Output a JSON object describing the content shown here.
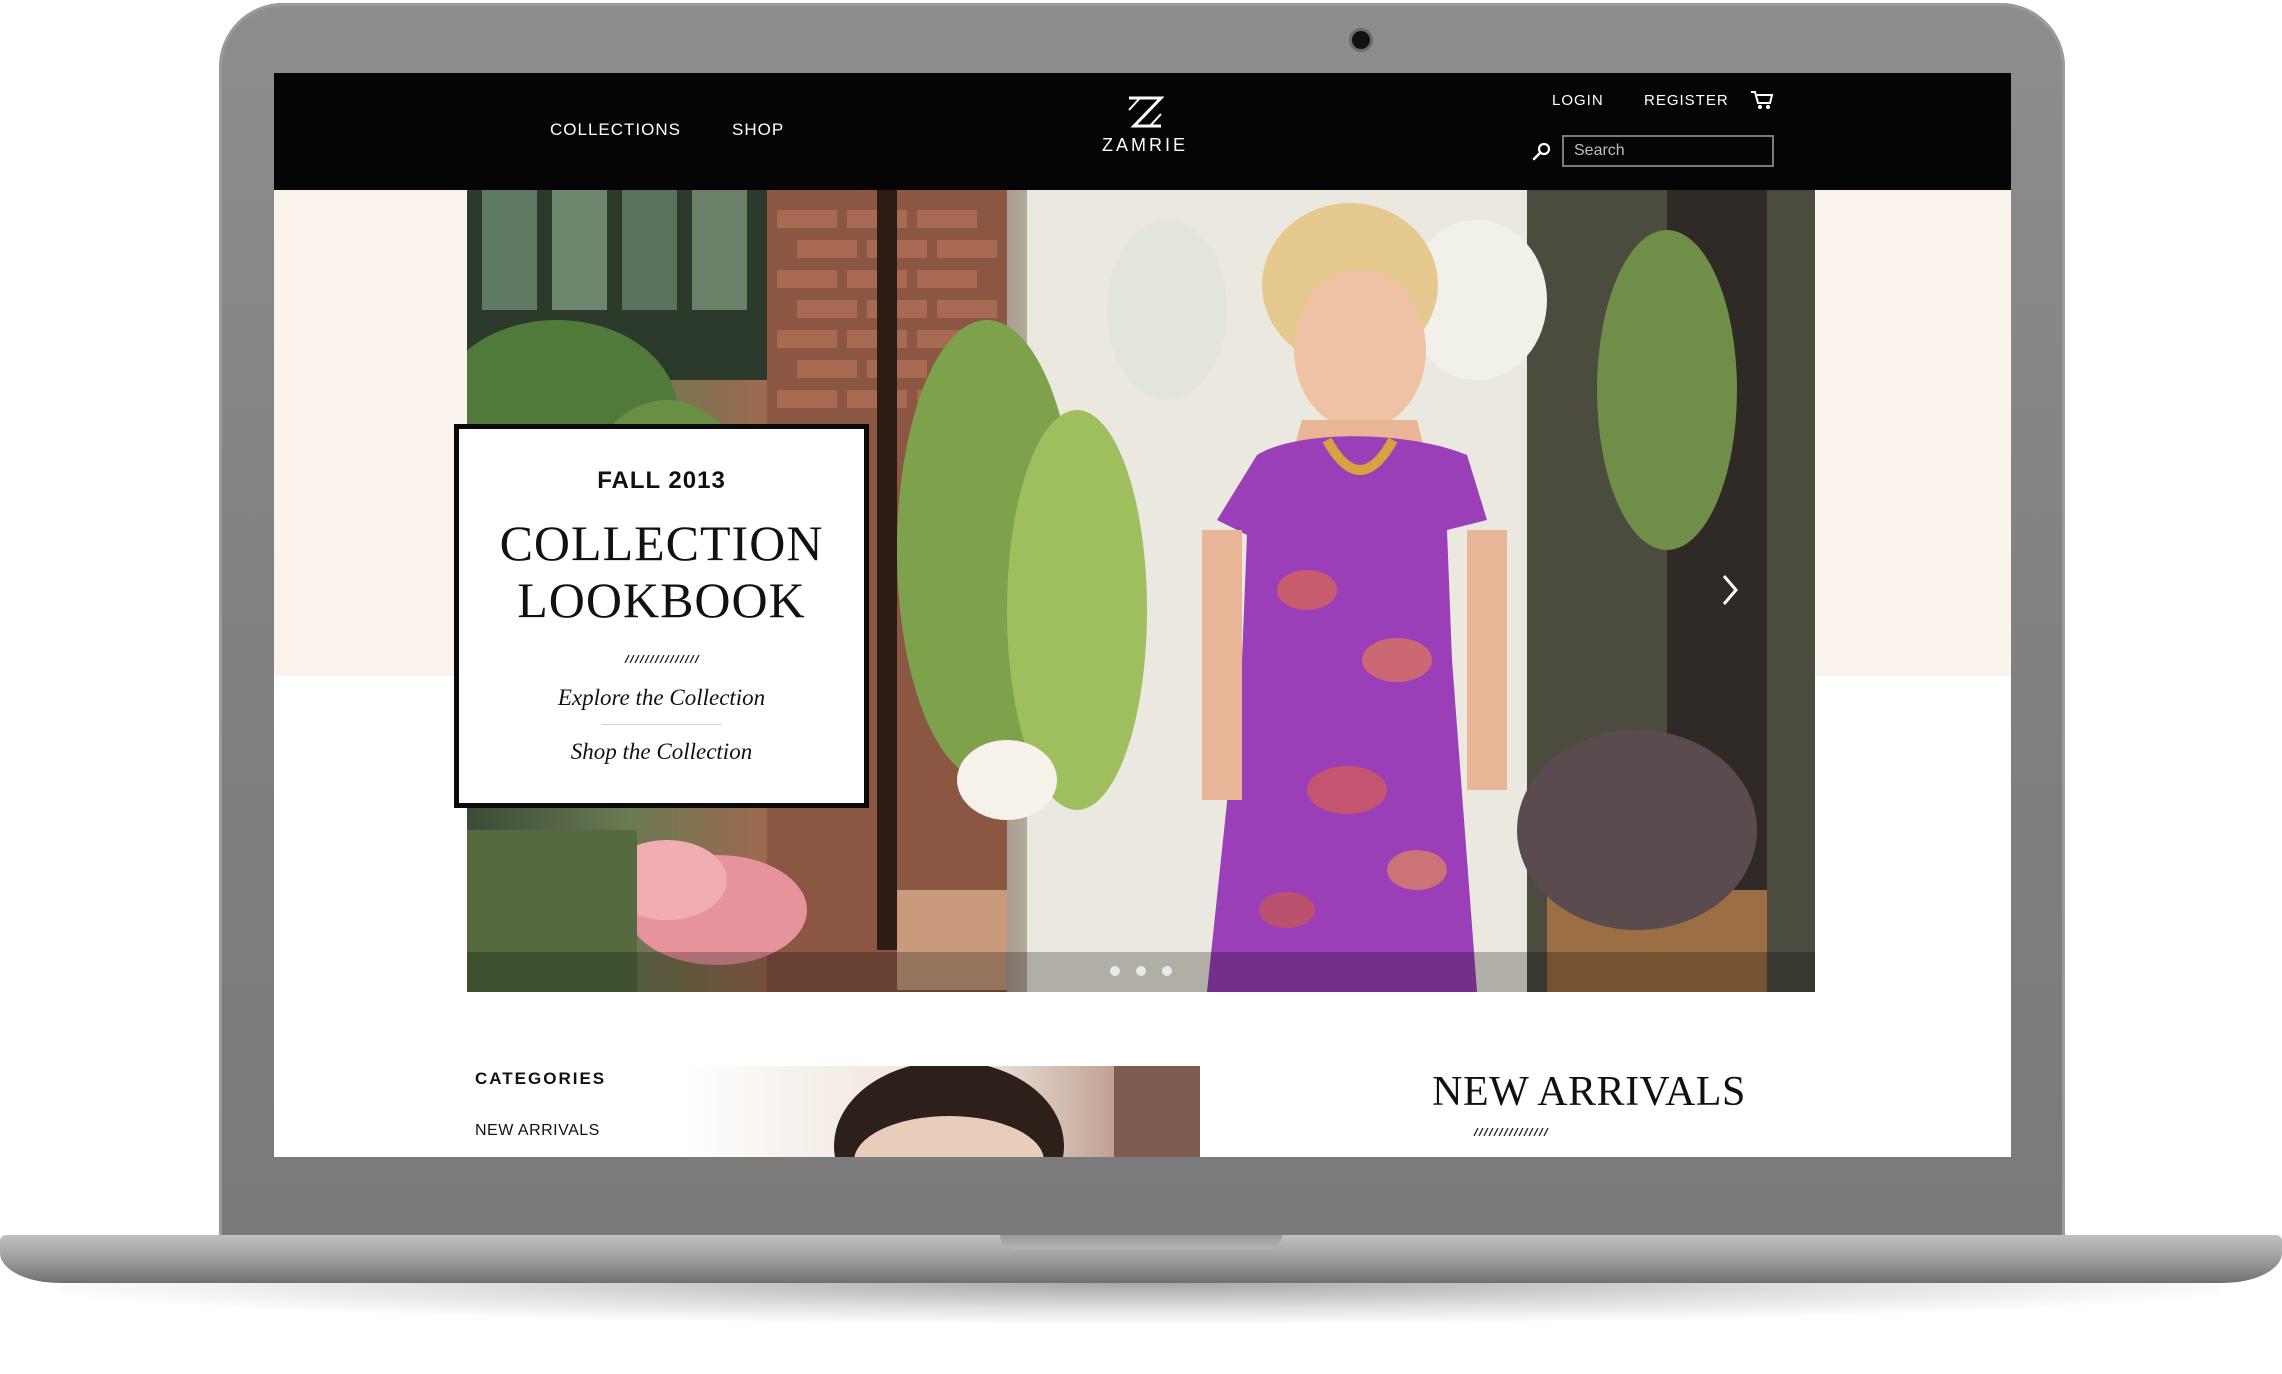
{
  "header": {
    "nav": [
      "COLLECTIONS",
      "SHOP"
    ],
    "brand": "ZAMRIE",
    "login": "LOGIN",
    "register": "REGISTER",
    "search_placeholder": "Search"
  },
  "hero": {
    "card": {
      "season": "FALL 2013",
      "title": "COLLECTION\nLOOKBOOK",
      "link_explore": "Explore the Collection",
      "link_shop": "Shop the Collection"
    },
    "slides_total": 3,
    "slide_active": 1
  },
  "sidebar": {
    "heading": "CATEGORIES",
    "items": [
      "NEW ARRIVALS"
    ]
  },
  "main": {
    "arrivals_title": "NEW ARRIVALS"
  },
  "colors": {
    "header_bg": "#050505",
    "band_bg": "#fbf4ec",
    "dress_purple": "#9b3fb8"
  }
}
